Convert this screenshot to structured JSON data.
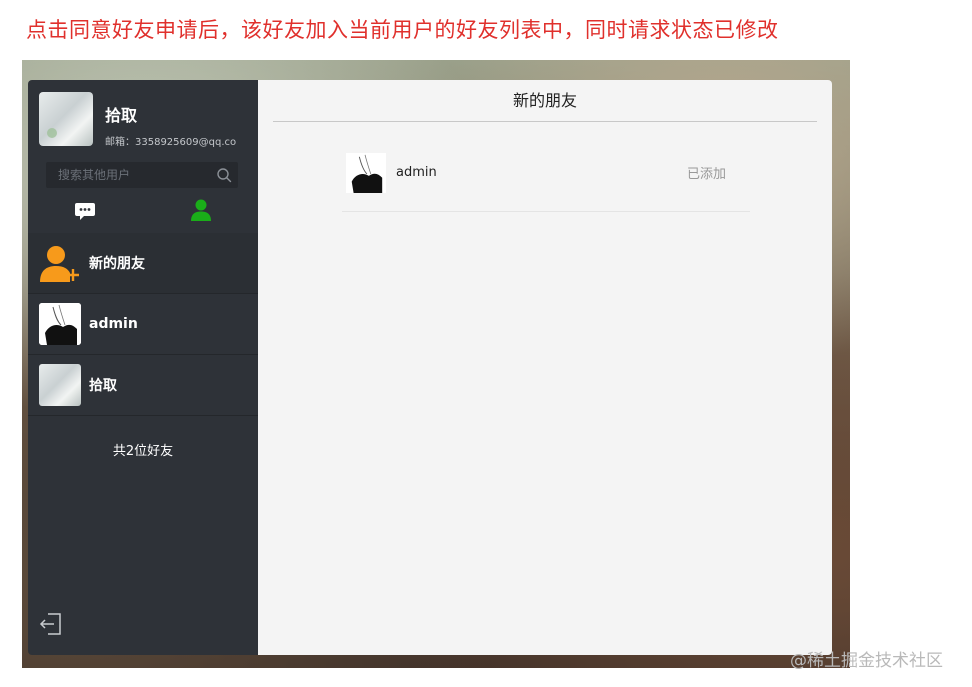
{
  "annotation": "点击同意好友申请后，该好友加入当前用户的好友列表中，同时请求状态已修改",
  "sidebar": {
    "profile": {
      "name": "拾取",
      "email": "邮箱：3358925609@qq.co"
    },
    "search": {
      "placeholder": "搜索其他用户",
      "value": ""
    },
    "tabs": [
      {
        "name": "chat",
        "icon": "chat-bubble-icon",
        "active": false
      },
      {
        "name": "contacts",
        "icon": "user-icon",
        "active": true
      }
    ],
    "items": [
      {
        "label": "新的朋友",
        "icon": "add-friend-icon"
      },
      {
        "label": "admin",
        "icon": "avatar"
      },
      {
        "label": "拾取",
        "icon": "avatar"
      }
    ],
    "friend_count": "共2位好友"
  },
  "main": {
    "title": "新的朋友",
    "requests": [
      {
        "name": "admin",
        "status": "已添加"
      }
    ]
  },
  "watermark": "@稀土掘金技术社区",
  "colors": {
    "sidebar_bg": "#2e3238",
    "accent_green": "#1aad19",
    "accent_orange": "#f79a1b",
    "annotation_red": "#e0302c"
  }
}
